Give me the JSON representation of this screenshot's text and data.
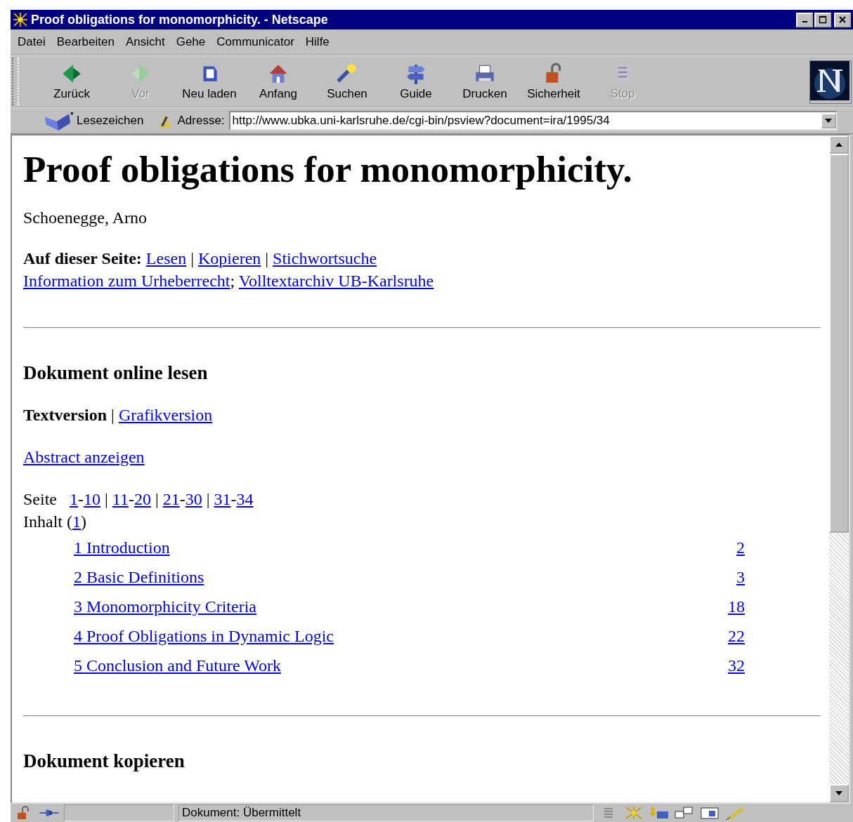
{
  "window": {
    "title": "Proof obligations for monomorphicity. - Netscape"
  },
  "menu": [
    "Datei",
    "Bearbeiten",
    "Ansicht",
    "Gehe",
    "Communicator",
    "Hilfe"
  ],
  "toolbar": [
    {
      "label": "Zurück",
      "kind": "back",
      "disabled": false
    },
    {
      "label": "Vor",
      "kind": "forward",
      "disabled": true
    },
    {
      "label": "Neu laden",
      "kind": "reload",
      "disabled": false
    },
    {
      "label": "Anfang",
      "kind": "home",
      "disabled": false
    },
    {
      "label": "Suchen",
      "kind": "search",
      "disabled": false
    },
    {
      "label": "Guide",
      "kind": "guide",
      "disabled": false
    },
    {
      "label": "Drucken",
      "kind": "print",
      "disabled": false
    },
    {
      "label": "Sicherheit",
      "kind": "security",
      "disabled": false
    },
    {
      "label": "Stop",
      "kind": "stop",
      "disabled": true
    }
  ],
  "location": {
    "bookmarks": "Lesezeichen",
    "address_label": "Adresse:",
    "url": "http://www.ubka.uni-karlsruhe.de/cgi-bin/psview?document=ira/1995/34"
  },
  "page": {
    "heading": "Proof obligations for monomorphicity.",
    "author": "Schoenegge, Arno",
    "on_page": [
      [
        {
          "kind": "bold",
          "text": "Auf dieser Seite: "
        },
        {
          "kind": "link",
          "text": "Lesen"
        },
        {
          "kind": "text",
          "text": " | "
        },
        {
          "kind": "link",
          "text": "Kopieren"
        },
        {
          "kind": "text",
          "text": " | "
        },
        {
          "kind": "link",
          "text": "Stichwortsuche"
        }
      ],
      [
        {
          "kind": "link",
          "text": "Information zum Urheberrecht"
        },
        {
          "kind": "text",
          "text": "; "
        },
        {
          "kind": "link",
          "text": "Volltextarchiv UB-Karlsruhe"
        }
      ]
    ],
    "read": {
      "heading": "Dokument online lesen",
      "version": [
        [
          {
            "kind": "bold",
            "text": "Textversion"
          },
          {
            "kind": "text",
            "text": " | "
          },
          {
            "kind": "link",
            "text": "Grafikversion"
          }
        ]
      ],
      "abstract": [
        [
          {
            "kind": "link",
            "text": "Abstract anzeigen"
          }
        ]
      ],
      "pages": [
        [
          {
            "kind": "text",
            "text": "Seite"
          },
          {
            "kind": "space"
          },
          {
            "kind": "link",
            "text": "1"
          },
          {
            "kind": "text",
            "text": "-"
          },
          {
            "kind": "link",
            "text": "10"
          },
          {
            "kind": "text",
            "text": " | "
          },
          {
            "kind": "link",
            "text": "11"
          },
          {
            "kind": "text",
            "text": "-"
          },
          {
            "kind": "link",
            "text": "20"
          },
          {
            "kind": "text",
            "text": " | "
          },
          {
            "kind": "link",
            "text": "21"
          },
          {
            "kind": "text",
            "text": "-"
          },
          {
            "kind": "link",
            "text": "30"
          },
          {
            "kind": "text",
            "text": " | "
          },
          {
            "kind": "link",
            "text": "31"
          },
          {
            "kind": "text",
            "text": "-"
          },
          {
            "kind": "link",
            "text": "34"
          }
        ],
        [
          {
            "kind": "text",
            "text": "Inhalt ("
          },
          {
            "kind": "link",
            "text": "1"
          },
          {
            "kind": "text",
            "text": ")"
          }
        ]
      ],
      "toc": [
        {
          "title": "1 Introduction",
          "page": "2"
        },
        {
          "title": "2 Basic Definitions",
          "page": "3"
        },
        {
          "title": "3 Monomorphicity Criteria",
          "page": "18"
        },
        {
          "title": "4 Proof Obligations in Dynamic Logic",
          "page": "22"
        },
        {
          "title": "5 Conclusion and Future Work",
          "page": "32"
        }
      ]
    },
    "copy": {
      "heading": "Dokument kopieren"
    }
  },
  "status_bar": {
    "text": "Dokument: Übermittelt"
  }
}
